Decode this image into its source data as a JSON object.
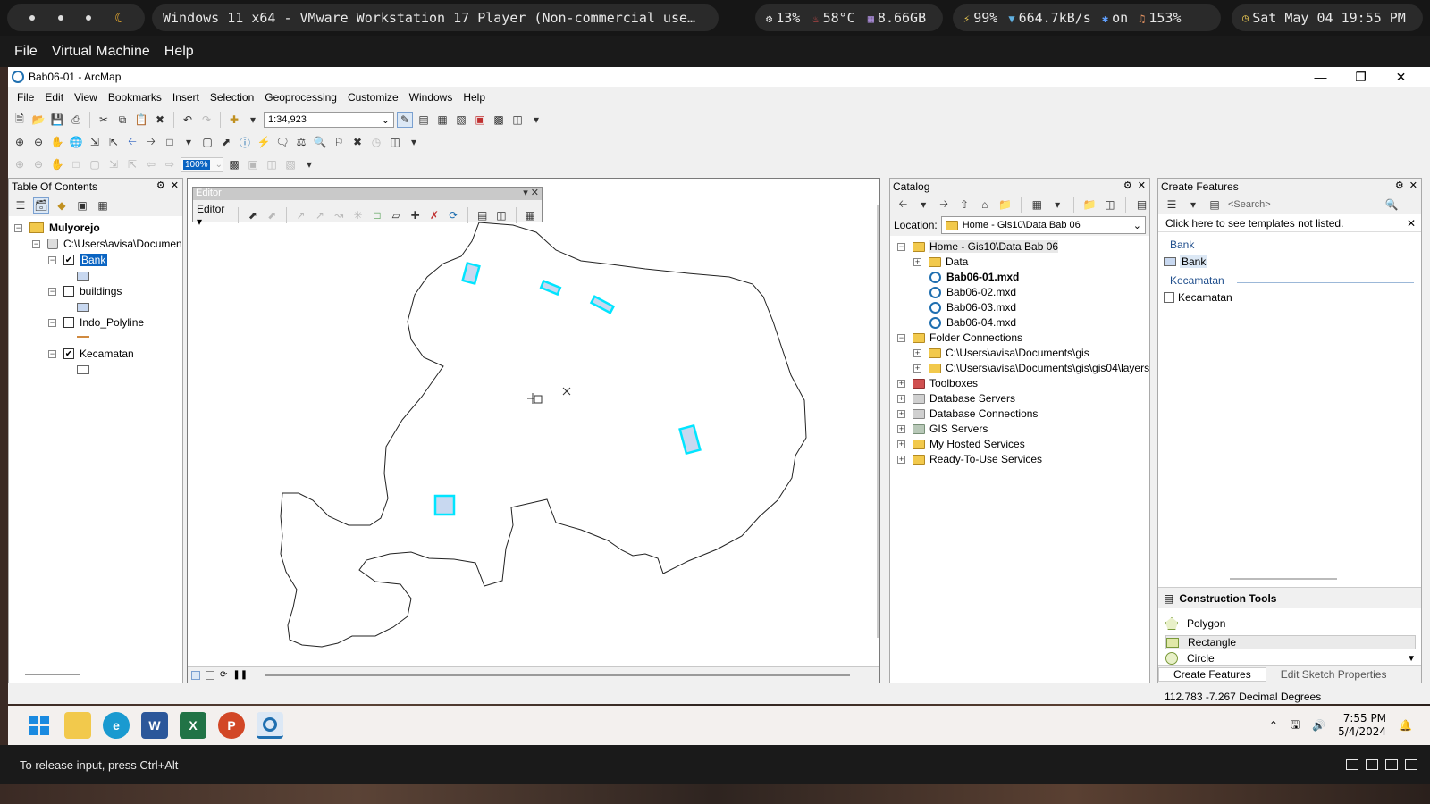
{
  "topbar": {
    "window_title": "Windows 11 x64 - VMware Workstation 17 Player (Non-commercial use…",
    "cpu": "13%",
    "temp": "58°C",
    "memory": "8.66GB",
    "battery": "99%",
    "net": "664.7kB/s",
    "bluetooth": "on",
    "volume": "153%",
    "datetime": "Sat May 04 19:55 PM"
  },
  "vm_menu": [
    "File",
    "Virtual Machine",
    "Help"
  ],
  "arcmap": {
    "title": "Bab06-01 - ArcMap",
    "menu": [
      "File",
      "Edit",
      "View",
      "Bookmarks",
      "Insert",
      "Selection",
      "Geoprocessing",
      "Customize",
      "Windows",
      "Help"
    ],
    "scale": "1:34,923",
    "zoom_value": "100%"
  },
  "toc": {
    "title": "Table Of Contents",
    "map_name": "Mulyorejo",
    "source": "C:\\Users\\avisa\\Documen",
    "layers": [
      {
        "name": "Bank",
        "checked": true,
        "selected": true
      },
      {
        "name": "buildings",
        "checked": false
      },
      {
        "name": "Indo_Polyline",
        "checked": false
      },
      {
        "name": "Kecamatan",
        "checked": true
      }
    ]
  },
  "editor": {
    "title": "Editor",
    "menu_label": "Editor ▾"
  },
  "catalog": {
    "title": "Catalog",
    "location_label": "Location:",
    "location_value": "Home - Gis10\\Data Bab 06",
    "tree": [
      "Home - Gis10\\Data Bab 06",
      "Data",
      "Bab06-01.mxd",
      "Bab06-02.mxd",
      "Bab06-03.mxd",
      "Bab06-04.mxd",
      "Folder Connections",
      "C:\\Users\\avisa\\Documents\\gis",
      "C:\\Users\\avisa\\Documents\\gis\\gis04\\layers",
      "Toolboxes",
      "Database Servers",
      "Database Connections",
      "GIS Servers",
      "My Hosted Services",
      "Ready-To-Use Services"
    ]
  },
  "create_features": {
    "title": "Create Features",
    "search_placeholder": "<Search>",
    "hint": "Click here to see templates not listed.",
    "groups": [
      {
        "group": "Bank",
        "item": "Bank"
      },
      {
        "group": "Kecamatan",
        "item": "Kecamatan"
      }
    ],
    "construction_title": "Construction Tools",
    "tools": [
      "Polygon",
      "Rectangle",
      "Circle"
    ],
    "tabs": [
      "Create Features",
      "Edit Sketch Properties"
    ]
  },
  "status": {
    "coords": "112.783  -7.267 Decimal Degrees"
  },
  "taskbar": {
    "apps": [
      "start",
      "file-explorer",
      "edge",
      "word",
      "excel",
      "powerpoint",
      "arcmap"
    ],
    "time": "7:55 PM",
    "date": "5/4/2024"
  },
  "vm_status": "To release input, press Ctrl+Alt",
  "colors": {
    "selection_cyan": "#00e5ff",
    "bank_fill": "#c8d8f0",
    "selected_layer": "#0a64c2"
  }
}
